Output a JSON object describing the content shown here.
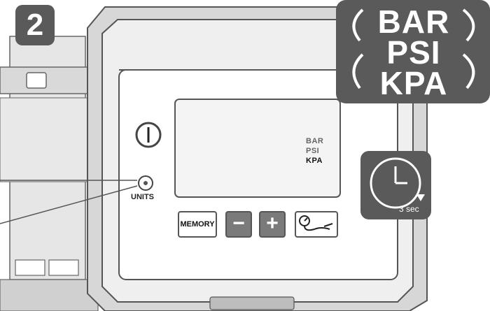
{
  "step": {
    "number": "2"
  },
  "units_panel": {
    "units": [
      "BAR",
      "PSI",
      "KPA"
    ]
  },
  "lcd": {
    "units": [
      "BAR",
      "PSI",
      "KPA"
    ],
    "active_unit": "KPA"
  },
  "controls": {
    "units_button_label": "UNITS",
    "memory_label": "MEMORY",
    "minus_label": "−",
    "plus_label": "+"
  },
  "timer": {
    "label": "3 sec",
    "icon": "clock-arrow-icon"
  },
  "colors": {
    "badge": "#5a5a5a",
    "device_bezel": "#cfcfcf",
    "outline": "#555555"
  }
}
